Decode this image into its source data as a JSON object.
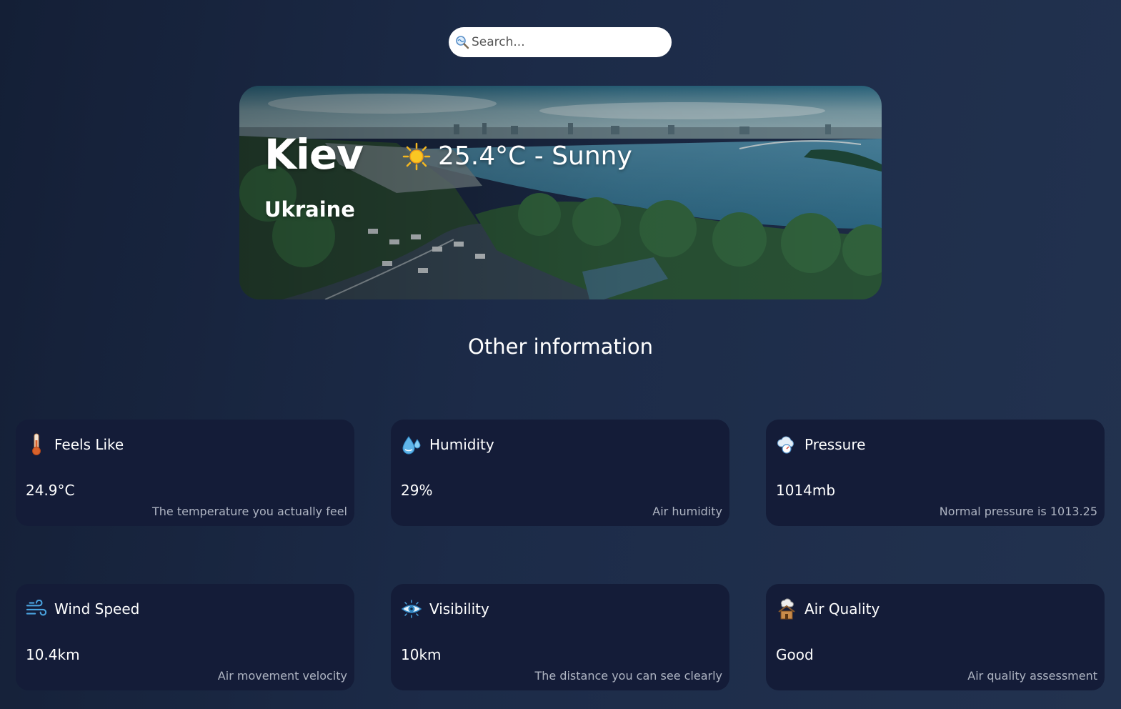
{
  "search": {
    "placeholder": "Search...",
    "icon": "search-cloud-icon"
  },
  "hero": {
    "city": "Kiev",
    "country": "Ukraine",
    "temperature": "25.4°C - Sunny",
    "condition_icon": "sun-icon"
  },
  "section_title": "Other information",
  "cards": [
    {
      "label": "Feels Like",
      "value": "24.9°C",
      "desc": "The temperature you actually feel",
      "icon": "thermometer-icon"
    },
    {
      "label": "Humidity",
      "value": "29%",
      "desc": "Air humidity",
      "icon": "humidity-drops-icon"
    },
    {
      "label": "Pressure",
      "value": "1014mb",
      "desc": "Normal pressure is 1013.25",
      "icon": "pressure-cloud-icon"
    },
    {
      "label": "Wind Speed",
      "value": "10.4km",
      "desc": "Air movement velocity",
      "icon": "wind-icon"
    },
    {
      "label": "Visibility",
      "value": "10km",
      "desc": "The distance you can see clearly",
      "icon": "eye-icon"
    },
    {
      "label": "Air Quality",
      "value": "Good",
      "desc": "Air quality assessment",
      "icon": "air-quality-house-icon"
    }
  ],
  "colors": {
    "background": "#1c2b48",
    "card": "#141c38",
    "accent_sun": "#f5b820"
  }
}
